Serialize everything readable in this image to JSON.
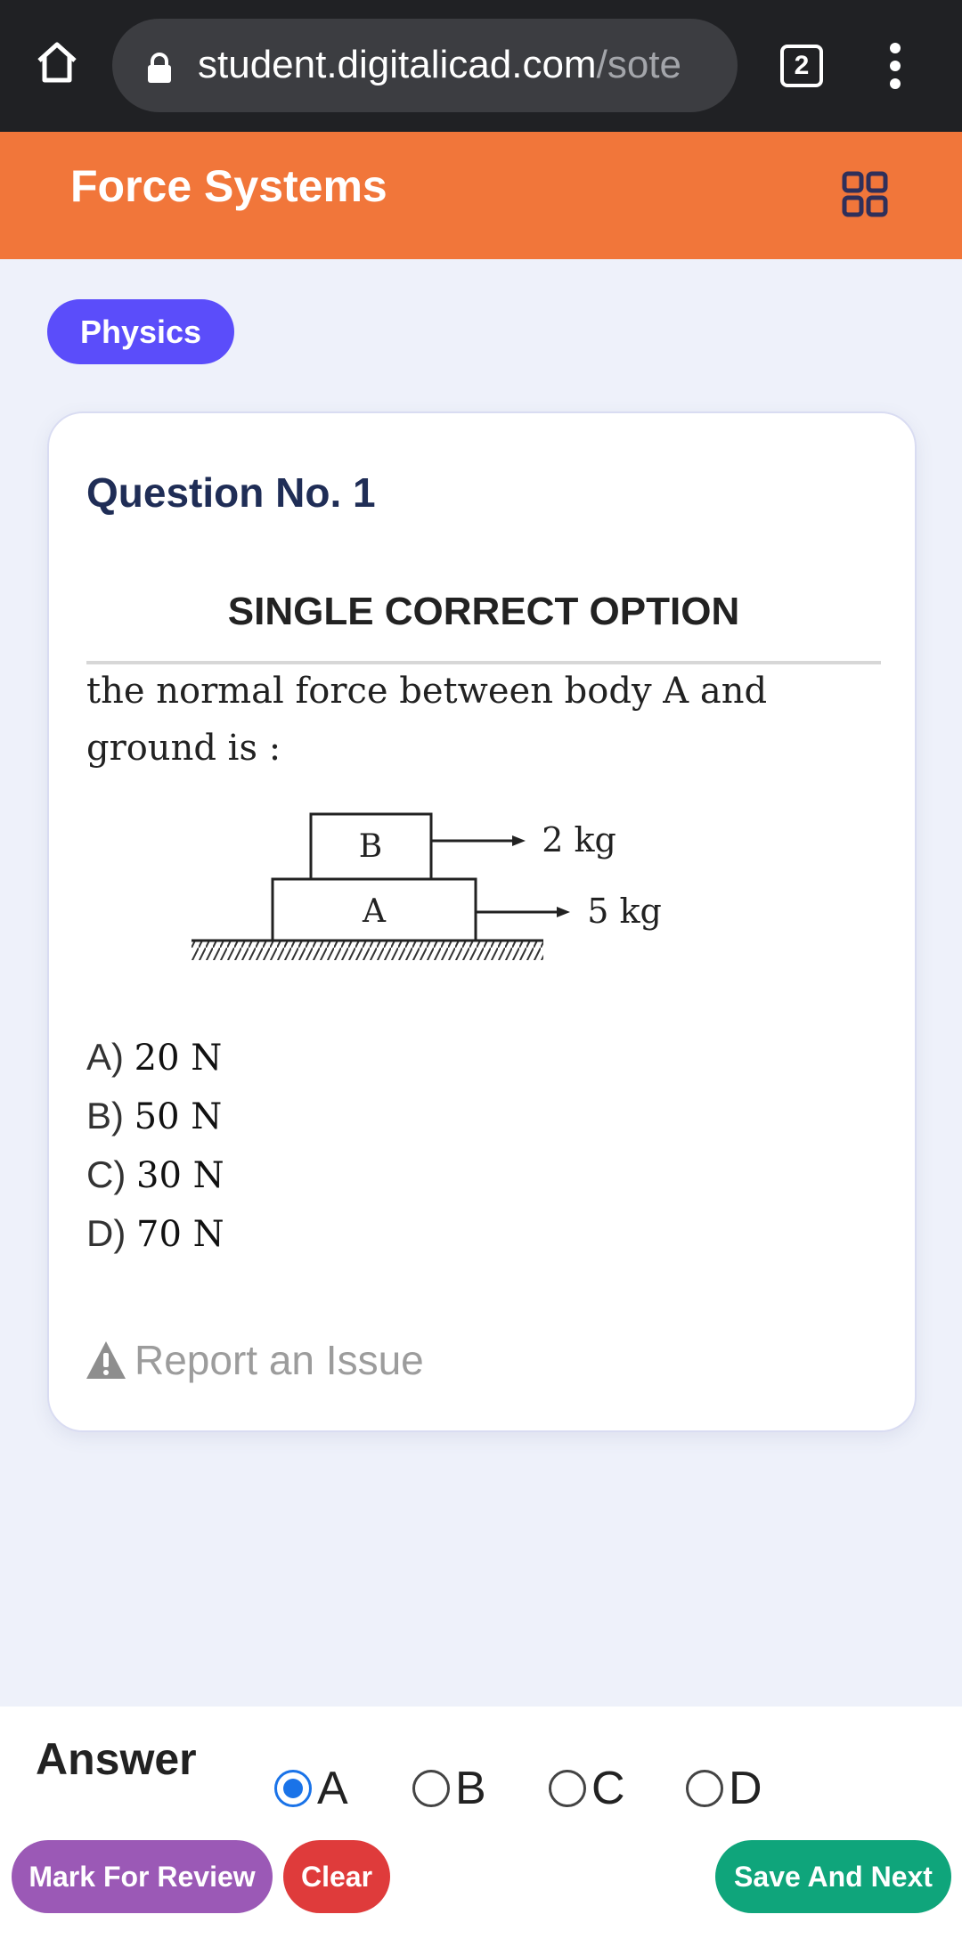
{
  "browser": {
    "url_host": "student.digitalicad.com",
    "url_path": "/sote",
    "tab_count": "2"
  },
  "header": {
    "title": "Force Systems"
  },
  "subject_badge": "Physics",
  "question": {
    "number_label": "Question No. 1",
    "type_label": "SINGLE CORRECT OPTION",
    "text": "the normal force between body A and ground is :",
    "figure": {
      "block_top": "B",
      "block_bottom": "A",
      "mass_top": "2 kg",
      "mass_bottom": "5 kg"
    },
    "options": [
      {
        "key": "A)",
        "value": "20 N"
      },
      {
        "key": "B)",
        "value": "50 N"
      },
      {
        "key": "C)",
        "value": "30 N"
      },
      {
        "key": "D)",
        "value": "70 N"
      }
    ],
    "report_label": "Report an Issue"
  },
  "answer": {
    "label": "Answer",
    "choices": [
      "A",
      "B",
      "C",
      "D"
    ],
    "selected": "A"
  },
  "buttons": {
    "review": "Mark For Review",
    "clear": "Clear",
    "next": "Save And Next"
  },
  "colors": {
    "header": "#f1763a",
    "subject": "#5b4dfa",
    "review": "#9b59b6",
    "clear": "#df3b3b",
    "next": "#0fa57b"
  }
}
